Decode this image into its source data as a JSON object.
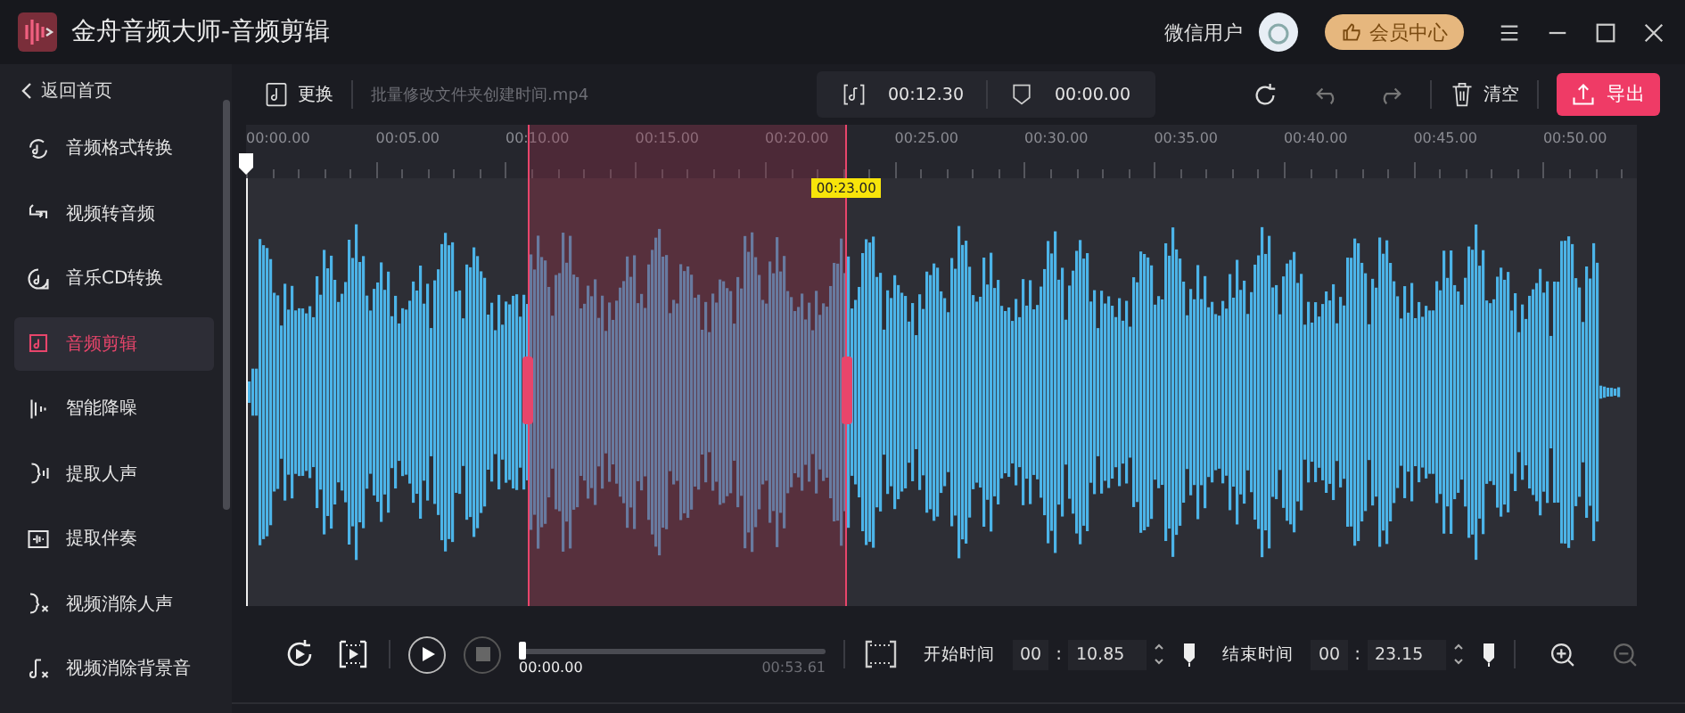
{
  "window": {
    "title": "金舟音频大师-音频剪辑"
  },
  "user": {
    "name": "微信用户"
  },
  "vip_button": "会员中心",
  "sidebar": {
    "back": "返回首页",
    "items": [
      {
        "label": "音频格式转换",
        "selected": false
      },
      {
        "label": "视频转音频",
        "selected": false
      },
      {
        "label": "音乐CD转换",
        "selected": false
      },
      {
        "label": "音频剪辑",
        "selected": true
      },
      {
        "label": "智能降噪",
        "selected": false
      },
      {
        "label": "提取人声",
        "selected": false
      },
      {
        "label": "提取伴奏",
        "selected": false
      },
      {
        "label": "视频消除人声",
        "selected": false
      },
      {
        "label": "视频消除背景音",
        "selected": false
      }
    ]
  },
  "toolbar": {
    "replace": "更换",
    "file_name": "批量修改文件夹创建时间.mp4",
    "selection_length": "00:12.30",
    "fade": "00:00.00",
    "clear": "清空",
    "export": "导出"
  },
  "ruler": {
    "labels": [
      "00:00.00",
      "00:05.00",
      "00:10.00",
      "00:15.00",
      "00:20.00",
      "00:25.00",
      "00:30.00",
      "00:35.00",
      "00:40.00",
      "00:45.00",
      "00:50.00"
    ]
  },
  "marker": "00:23.00",
  "playback": {
    "current": "00:00.00",
    "total": "00:53.61",
    "level": 0
  },
  "range": {
    "start_label": "开始时间",
    "start_min": "00",
    "start_sep": ":",
    "start_sec": "10.85",
    "end_label": "结束时间",
    "end_min": "00",
    "end_sep": ":",
    "end_sec": "23.15"
  }
}
